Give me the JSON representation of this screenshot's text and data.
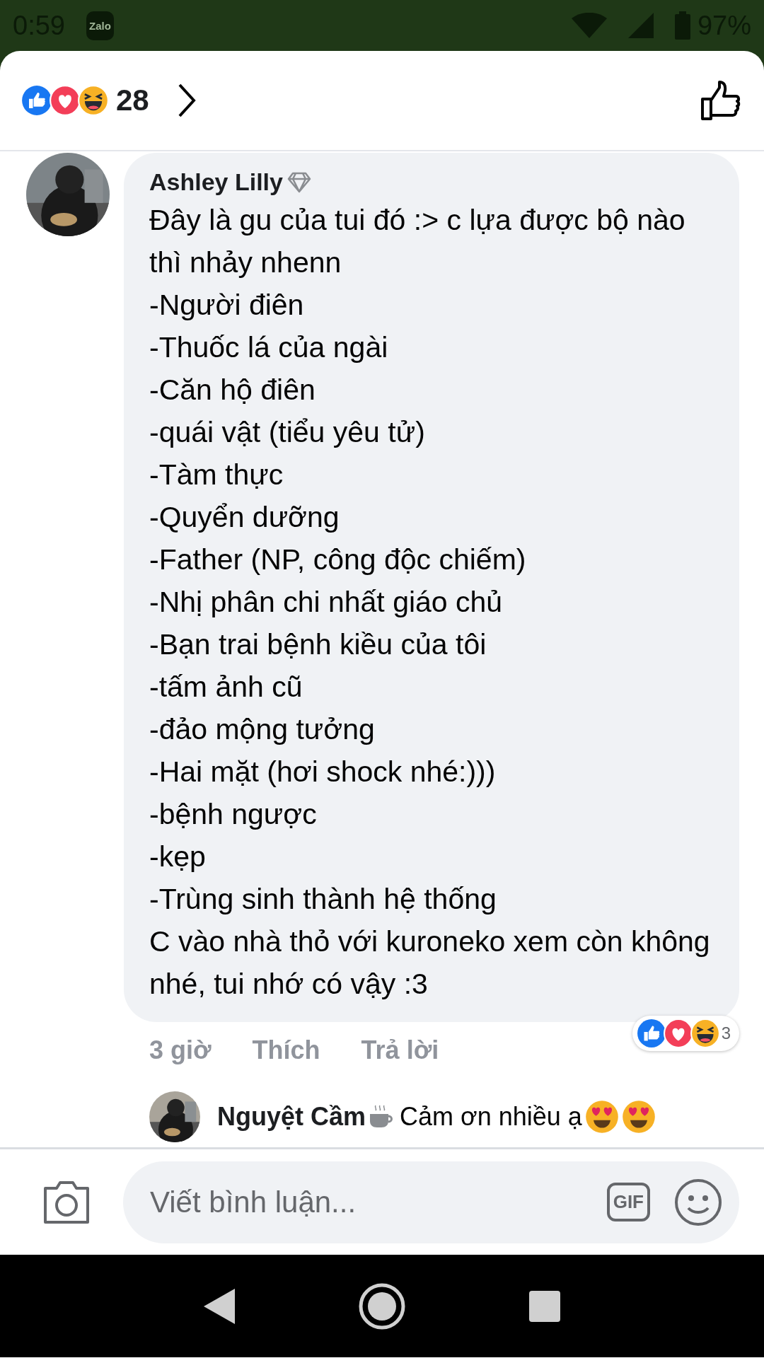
{
  "status_bar": {
    "time": "0:59",
    "notification_app": "Zalo",
    "battery": "97%"
  },
  "header": {
    "reaction_count": "28"
  },
  "comment": {
    "author": "Ashley Lilly",
    "text": "Đây là gu của tui đó :> c lựa được bộ nào thì nhảy nhenn\n-Người điên\n-Thuốc lá của ngài\n-Căn hộ điên\n-quái vật (tiểu yêu tử)\n-Tàm thực\n-Quyển dưỡng\n-Father (NP, công độc chiếm)\n-Nhị phân chi nhất giáo chủ\n-Bạn trai bệnh kiều của tôi\n-tấm ảnh cũ\n-đảo mộng tưởng\n-Hai mặt (hơi shock nhé:)))\n-bệnh ngược\n-kẹp\n-Trùng sinh thành hệ thống\nC vào nhà thỏ với kuroneko xem còn không nhé, tui nhớ có vậy :3",
    "time": "3 giờ",
    "actions": [
      "Thích",
      "Trả lời"
    ],
    "reaction_count": "3"
  },
  "reply": {
    "author": "Nguyệt Cầm",
    "text": "Cảm ơn nhiều ạ"
  },
  "composer": {
    "placeholder": "Viết bình luận...",
    "gif_label": "GIF"
  }
}
